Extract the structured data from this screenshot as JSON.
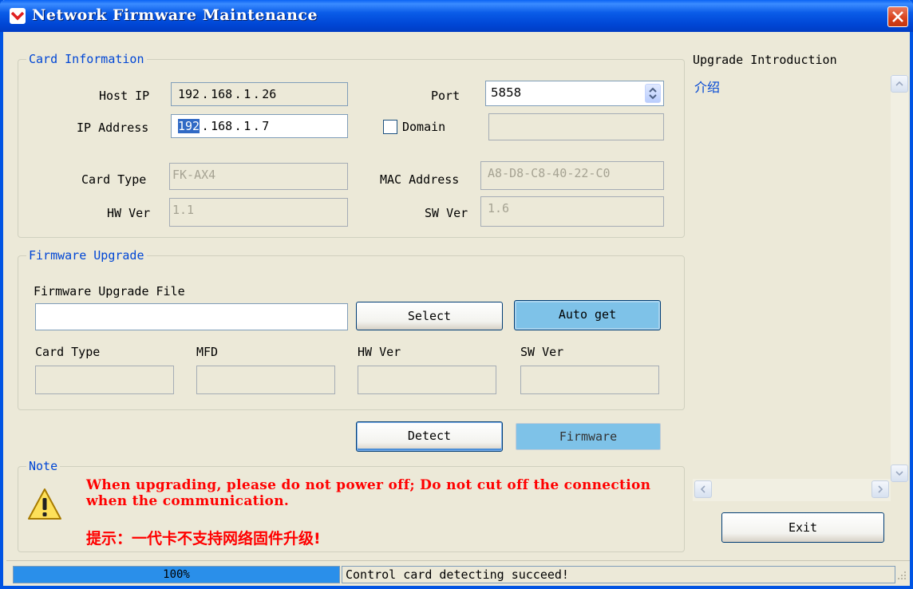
{
  "window": {
    "title": "Network Firmware Maintenance"
  },
  "card_info": {
    "group_label": "Card Information",
    "host_ip_label": "Host IP",
    "host_ip": [
      "192",
      "168",
      "1",
      "26"
    ],
    "port_label": "Port",
    "port_value": "5858",
    "ip_address_label": "IP Address",
    "ip_address": [
      "192",
      "168",
      "1",
      "7"
    ],
    "domain_label": "Domain",
    "domain_value": "",
    "card_type_label": "Card Type",
    "card_type_value": "FK-AX4",
    "mac_label": "MAC Address",
    "mac_value": "A8-D8-C8-40-22-C0",
    "hw_ver_label": "HW Ver",
    "hw_ver_value": "1.1",
    "sw_ver_label": "SW Ver",
    "sw_ver_value": "1.6"
  },
  "firmware": {
    "group_label": "Firmware Upgrade",
    "file_label": "Firmware Upgrade File",
    "file_value": "",
    "select_label": "Select",
    "auto_get_label": "Auto get",
    "card_type_label": "Card Type",
    "mfd_label": "MFD",
    "hw_ver_label": "HW Ver",
    "sw_ver_label": "SW Ver",
    "card_type_value": "",
    "mfd_value": "",
    "hw_ver_value": "",
    "sw_ver_value": ""
  },
  "actions": {
    "detect_label": "Detect",
    "firmware_label": "Firmware"
  },
  "note": {
    "group_label": "Note",
    "warning_en": "When upgrading, please do not power off; Do not cut off the connection when the communication.",
    "warning_cn": "提示：一代卡不支持网络固件升级!"
  },
  "intro": {
    "title": "Upgrade Introduction",
    "text": "介绍"
  },
  "exit_label": "Exit",
  "status": {
    "progress": 1.0,
    "progress_text": "100%",
    "message": "Control card detecting succeed!"
  },
  "colors": {
    "title_bar": "#0054e3",
    "group_label": "#0046d5",
    "warning_text": "#ff0000",
    "progress_fill": "#2a8fea",
    "highlight_button": "#7ec2e8"
  }
}
